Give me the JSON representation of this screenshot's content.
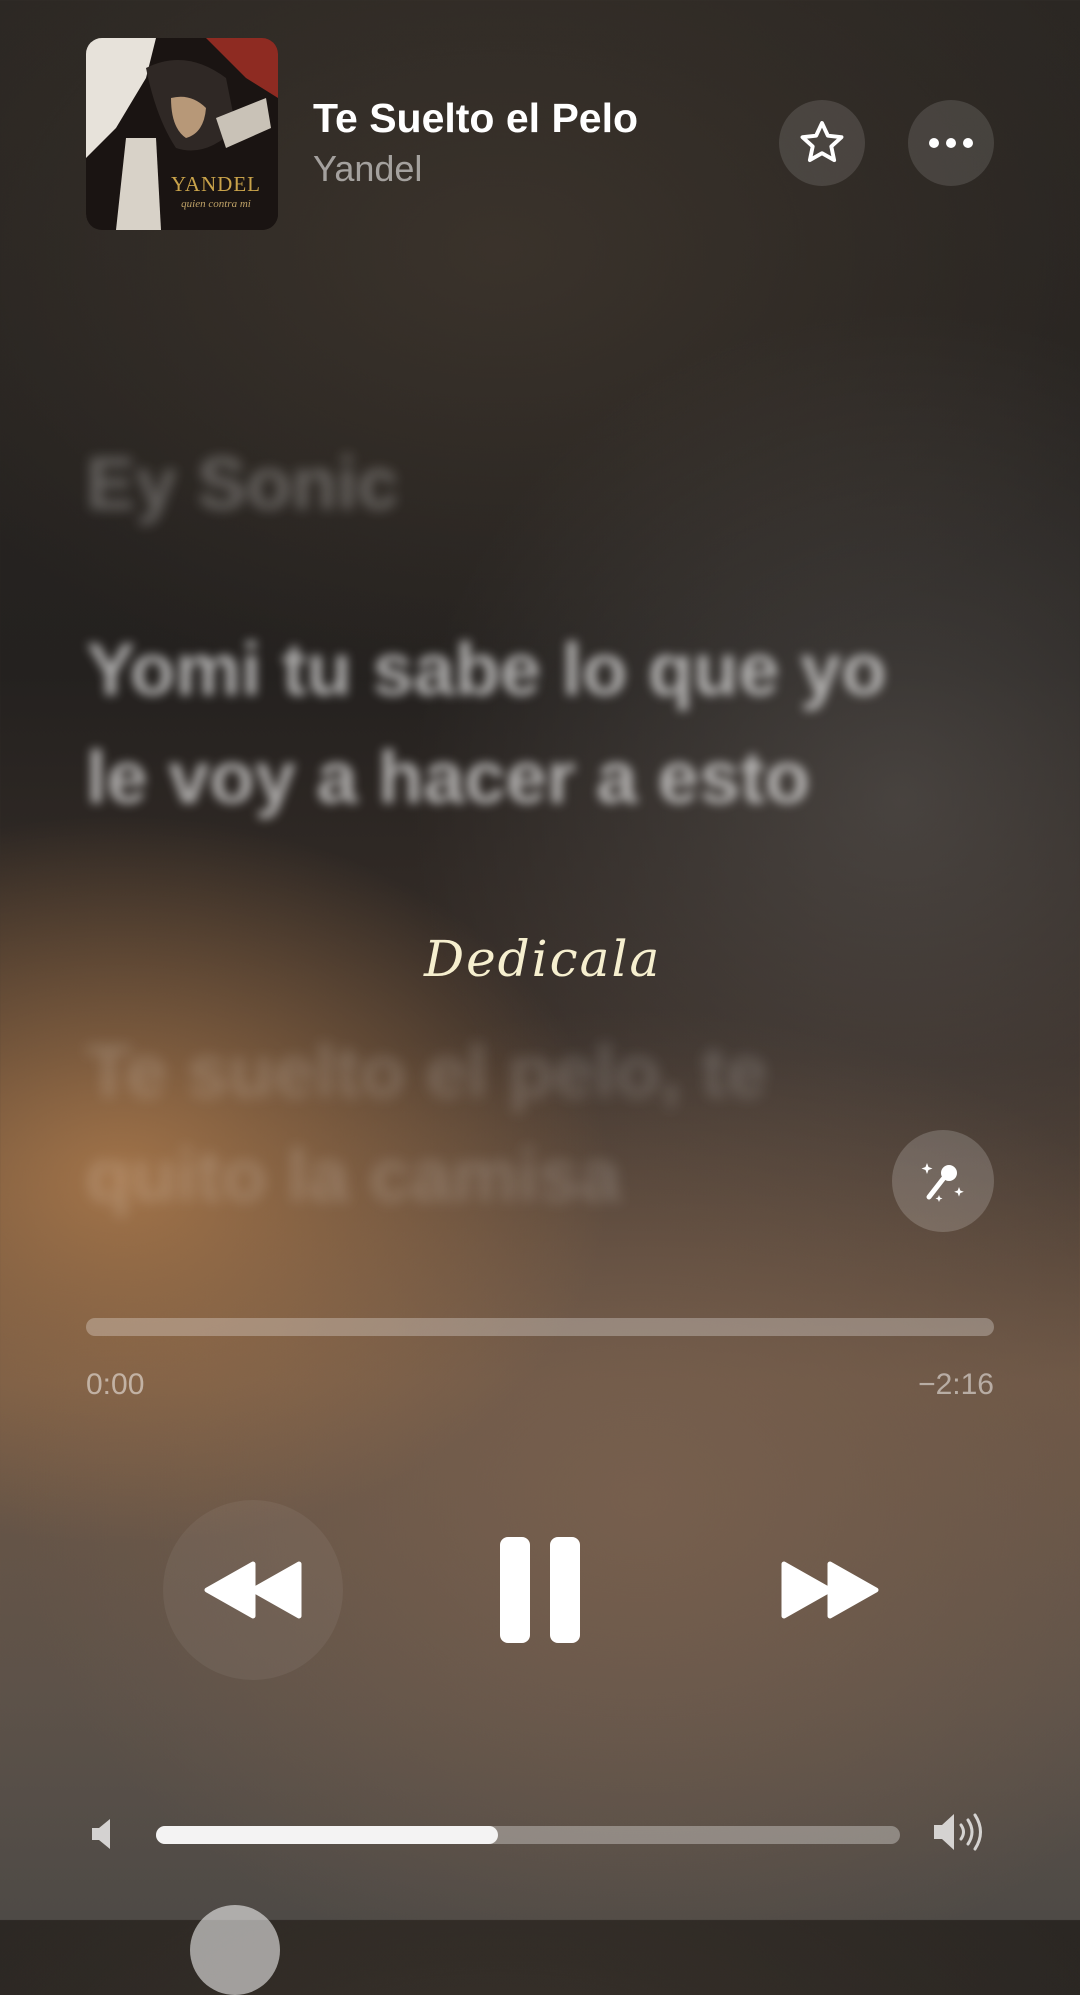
{
  "now_playing": {
    "title": "Te Suelto el Pelo",
    "artist": "Yandel",
    "album_art": {
      "artist_logo": "YANDEL",
      "album_subtitle": "quien contra mi"
    }
  },
  "header_actions": {
    "favorite_icon": "star-icon",
    "more_icon": "ellipsis-icon"
  },
  "lyrics": {
    "past_line": "Ey Sonic",
    "current_line": "Yomi tu sabe lo que yo le voy a hacer a esto",
    "next_line": "Te suelto el pelo, te quito la camisa",
    "overlay_text": "Dedicala",
    "sing_icon": "microphone-sparkle-icon"
  },
  "playback": {
    "elapsed": "0:00",
    "remaining": "−2:16",
    "progress_fraction": 0.0
  },
  "transport": {
    "rewind_icon": "backward-icon",
    "pause_icon": "pause-icon",
    "forward_icon": "forward-icon"
  },
  "volume": {
    "level_fraction": 0.46,
    "min_icon": "speaker-low-icon",
    "max_icon": "speaker-high-icon"
  },
  "colors": {
    "accent_text": "#ffffff",
    "secondary_text": "#8f8a85",
    "art_logo": "#c9a34a"
  }
}
